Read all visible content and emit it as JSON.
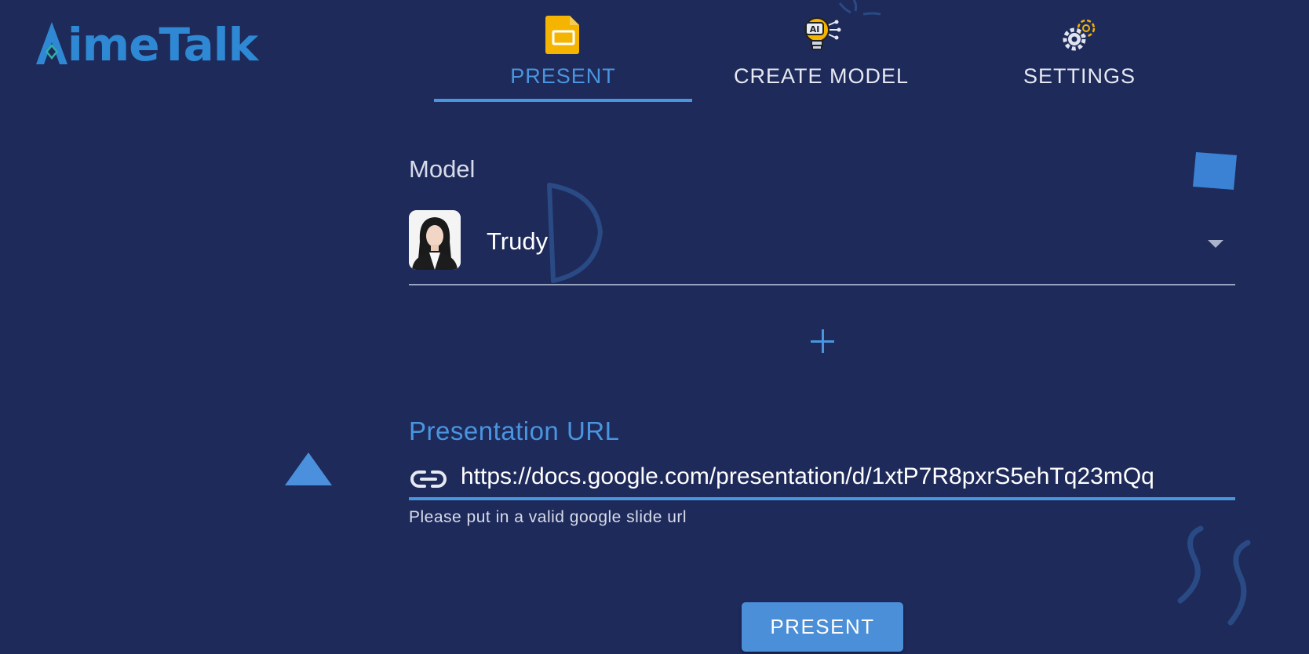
{
  "app": {
    "logo_text": "AimeTalk"
  },
  "tabs": [
    {
      "label": "PRESENT",
      "icon": "slides-icon",
      "active": true
    },
    {
      "label": "CREATE MODEL",
      "icon": "ai-bulb-icon",
      "active": false
    },
    {
      "label": "SETTINGS",
      "icon": "gears-icon",
      "active": false
    }
  ],
  "form": {
    "model_label": "Model",
    "selected_model": "Trudy",
    "url_label": "Presentation URL",
    "url_value": "https://docs.google.com/presentation/d/1xtP7R8pxrS5ehTq23mQq",
    "helper_text": "Please put in a valid google slide url",
    "submit_label": "PRESENT"
  },
  "colors": {
    "background": "#1e2a5a",
    "accent": "#4a95e0",
    "logo": "#2f88d3"
  }
}
